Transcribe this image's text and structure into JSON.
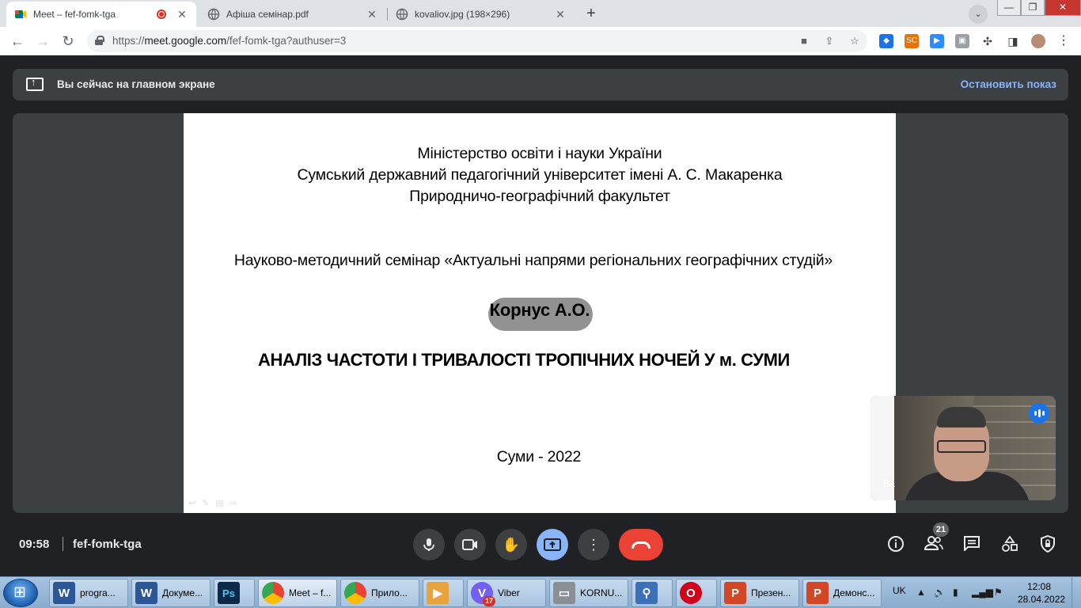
{
  "browser": {
    "tabs": [
      {
        "title": "Meet – fef-fomk-tga",
        "active": true,
        "recording": true,
        "favicon": "google-meet-icon"
      },
      {
        "title": "Афіша семінар.pdf",
        "active": false,
        "favicon": "globe-icon"
      },
      {
        "title": "kovaliov.jpg (198×296)",
        "active": false,
        "favicon": "globe-icon"
      }
    ],
    "new_tab": "+",
    "url": {
      "prefix": "https://",
      "host": "meet.google.com",
      "path": "/fef-fomk-tga?authuser=3"
    },
    "window_controls": {
      "minimize": "—",
      "restore": "❐",
      "close": "✕"
    }
  },
  "meet": {
    "banner": {
      "text": "Вы сейчас на главном экране",
      "stop": "Остановить показ"
    },
    "slide": {
      "line1": "Міністерство освіти і науки України",
      "line2": "Сумський державний педагогічний університет імені А. С. Макаренка",
      "line3": "Природничо-географічний факультет",
      "seminar": "Науково-методичний семінар «Актуальні напрями регіональних географічних студій»",
      "author": "Корнус А.О.",
      "title": "АНАЛІЗ ЧАСТОТИ І ТРИВАЛОСТІ ТРОПІЧНИХ НОЧЕЙ У м. СУМИ",
      "place_year": "Суми - 2022"
    },
    "self_view": {
      "name": "Ва"
    },
    "bottom_bar": {
      "time": "09:58",
      "meeting_code": "fef-fomk-tga",
      "participants_count": "21",
      "controls": [
        "microphone-icon",
        "camera-icon",
        "raise-hand-icon",
        "present-screen-icon",
        "more-options-icon",
        "leave-call-icon"
      ],
      "right_controls": [
        "info-icon",
        "people-icon",
        "chat-icon",
        "activities-icon",
        "host-controls-icon"
      ]
    }
  },
  "taskbar": {
    "items": [
      {
        "label": "progra...",
        "icon": "W",
        "color": "#2b5797"
      },
      {
        "label": "Докуме...",
        "icon": "W",
        "color": "#2b5797"
      },
      {
        "label": "",
        "icon": "Ps",
        "color": "#0b2a4a"
      },
      {
        "label": "Meet – f...",
        "icon": "",
        "color": "#ffffff"
      },
      {
        "label": "Прило...",
        "icon": "",
        "color": "#ffffff"
      },
      {
        "label": "",
        "icon": "▶",
        "color": "#e8a33d"
      },
      {
        "label": "Viber",
        "icon": "V",
        "color": "#7360f2",
        "badge": "17"
      },
      {
        "label": "KORNU...",
        "icon": "▭",
        "color": "#8a8f96"
      },
      {
        "label": "",
        "icon": "⚲",
        "color": "#3b6fb6"
      },
      {
        "label": "",
        "icon": "O",
        "color": "#d0021b"
      },
      {
        "label": "Презен...",
        "icon": "P",
        "color": "#d24726"
      },
      {
        "label": "Демонс...",
        "icon": "P",
        "color": "#d24726"
      }
    ],
    "language": "UK",
    "clock_time": "12:08",
    "clock_date": "28.04.2022"
  }
}
